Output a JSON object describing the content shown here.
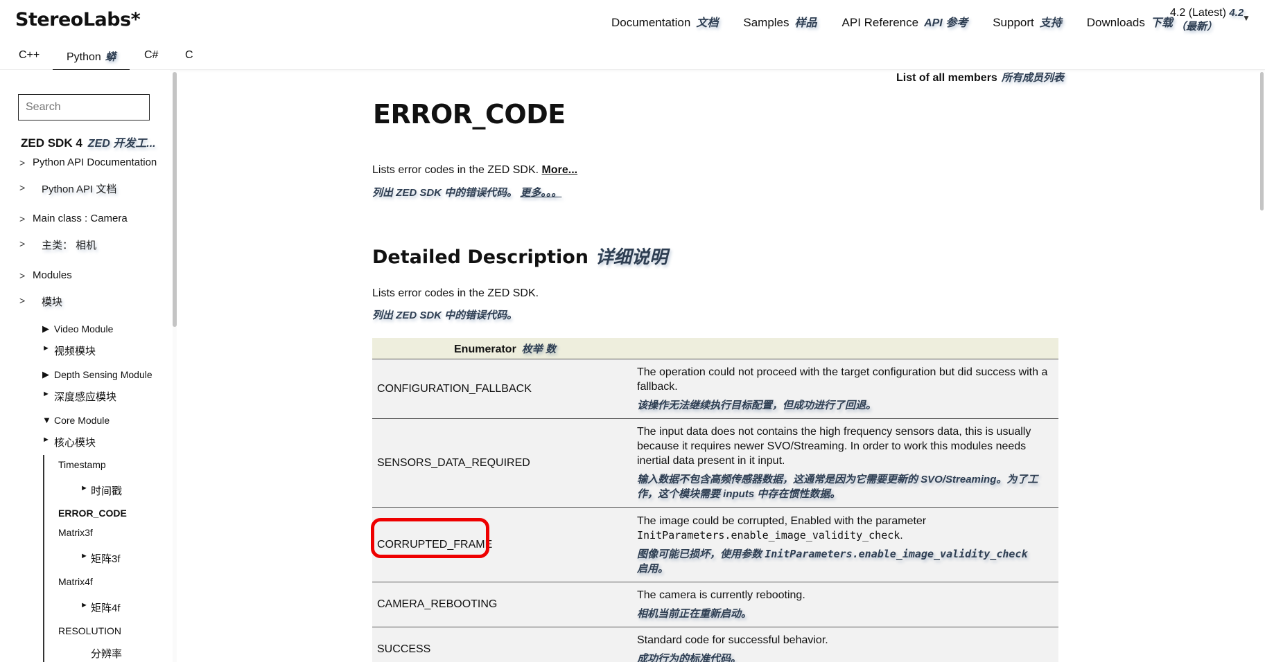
{
  "header": {
    "brand": "StereoLabs*",
    "nav": [
      {
        "label": "Documentation",
        "zh": "文档"
      },
      {
        "label": "Samples",
        "zh": "样品"
      },
      {
        "label": "API Reference",
        "zh": "API 参考"
      },
      {
        "label": "Support",
        "zh": "支持"
      },
      {
        "label": "Downloads",
        "zh": "下载"
      }
    ],
    "version": {
      "label": "4.2 (Latest)",
      "zh_a": "4.2",
      "zh_b": "（最新）"
    }
  },
  "lang_tabs": [
    {
      "label": "C++",
      "zh": ""
    },
    {
      "label": "Python",
      "zh": "蟒"
    },
    {
      "label": "C#",
      "zh": ""
    },
    {
      "label": "C",
      "zh": ""
    }
  ],
  "sidebar": {
    "search_placeholder": "Search",
    "sdk_title": "ZED SDK 4",
    "sdk_title_zh": "ZED 开发工...",
    "items": [
      {
        "label": "Python API Documentation",
        "zh": "Python API 文档"
      },
      {
        "label": "Main class : Camera",
        "zh": "主类： 相机"
      },
      {
        "label": "Modules",
        "zh": "模块"
      }
    ],
    "modules": [
      {
        "label": "Video Module",
        "zh": "视频模块"
      },
      {
        "label": "Depth Sensing Module",
        "zh": "深度感应模块"
      },
      {
        "label": "Core Module",
        "zh": "核心模块"
      }
    ],
    "core_items": [
      {
        "label": "Timestamp",
        "zh": "时间戳"
      },
      {
        "label": "ERROR_CODE",
        "zh": ""
      },
      {
        "label": "Matrix3f",
        "zh": "矩阵3f"
      },
      {
        "label": "Matrix4f",
        "zh": "矩阵4f"
      },
      {
        "label": "RESOLUTION",
        "zh": "分辨率"
      }
    ]
  },
  "main": {
    "members_link": "List of all members",
    "members_link_zh": "所有成员列表",
    "title": "ERROR_CODE",
    "brief": "Lists error codes in the ZED SDK.",
    "more": "More...",
    "brief_zh": "列出 ZED SDK 中的错误代码。",
    "more_zh": "更多。。。",
    "detail_heading": "Detailed Description",
    "detail_heading_zh": "详细说明",
    "detail_text": "Lists error codes in the ZED SDK.",
    "detail_text_zh": "列出 ZED SDK 中的错误代码。",
    "table_header": "Enumerator",
    "table_header_zh": "枚举 数",
    "rows": [
      {
        "name": "CONFIGURATION_FALLBACK",
        "desc": "The operation could not proceed with the target configuration but did success with a fallback.",
        "zh": "该操作无法继续执行目标配置，但成功进行了回退。"
      },
      {
        "name": "SENSORS_DATA_REQUIRED",
        "desc": "The input data does not contains the high frequency sensors data, this is usually because it requires newer SVO/Streaming. In order to work this modules needs inertial data present in it input.",
        "zh": "输入数据不包含高频传感器数据，这通常是因为它需要更新的 SVO/Streaming。为了工作，这个模块需要 inputs 中存在惯性数据。"
      },
      {
        "name": "CORRUPTED_FRAME",
        "desc": "The image could be corrupted, Enabled with the parameter",
        "code": "InitParameters.enable_image_validity_check",
        "desc_end": ".",
        "zh": "图像可能已损坏，使用参数",
        "zh_code": "InitParameters.enable_image_validity_check",
        "zh_end": "启用。"
      },
      {
        "name": "CAMERA_REBOOTING",
        "desc": "The camera is currently rebooting.",
        "zh": "相机当前正在重新启动。"
      },
      {
        "name": "SUCCESS",
        "desc": "Standard code for successful behavior.",
        "zh": "成功行为的标准代码。"
      }
    ]
  }
}
